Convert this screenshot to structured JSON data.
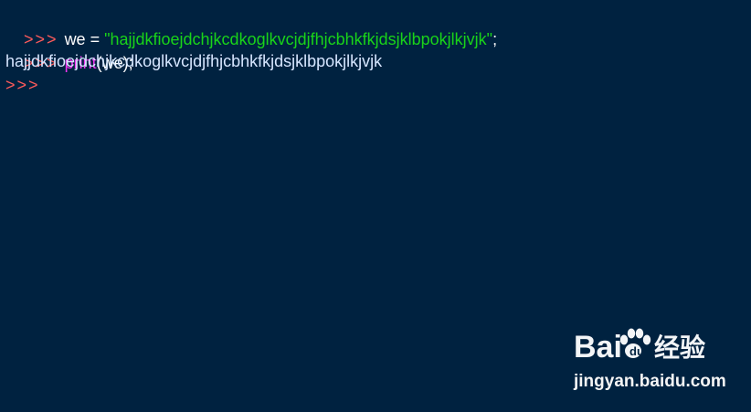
{
  "console": {
    "prompt": ">>>",
    "lines": [
      {
        "variable": "we",
        "operator": " = ",
        "string_value": "\"hajjdkfioejdchjkcdkoglkvcjdjfhjcbhkfkjdsjklbpokjlkjvjk\"",
        "terminator": ";"
      },
      {
        "function": "print",
        "arguments": "(we);"
      }
    ],
    "output": "hajjdkfioejdchjkcdkoglkvcjdjfhjcbhkfkjdsjklbpokjlkjvjk",
    "empty_prompt": ">>>"
  },
  "watermark": {
    "brand": "Bai 经验",
    "url": "jingyan.baidu.com"
  },
  "colors": {
    "background": "#002240",
    "prompt": "#ff5b5b",
    "string": "#19d319",
    "builtin": "#ef35ef",
    "output": "#d7e6ff"
  }
}
